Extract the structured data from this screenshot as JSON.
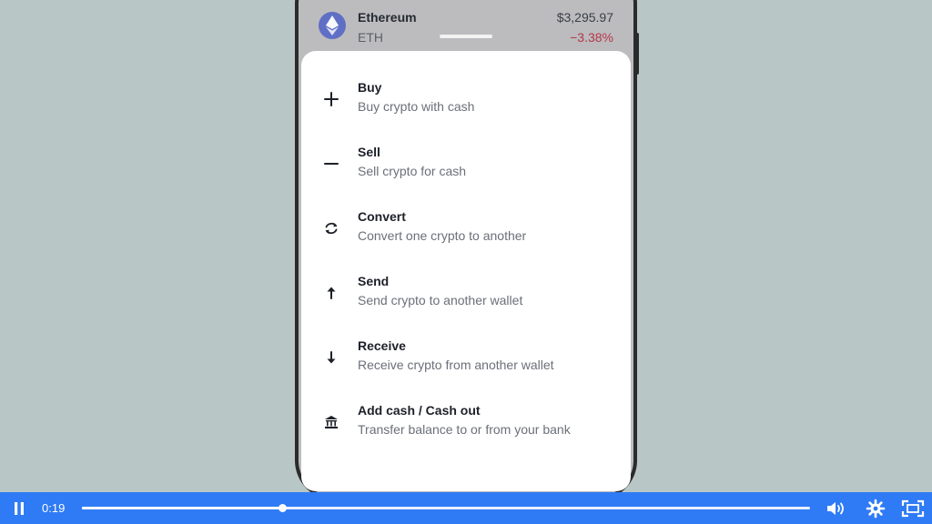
{
  "asset": {
    "name": "Ethereum",
    "symbol": "ETH",
    "price": "$3,295.97",
    "change": "−3.38%",
    "logo_icon": "ethereum-icon",
    "logo_color": "#5f6fc5",
    "change_color": "#b5364a"
  },
  "menu": {
    "items": [
      {
        "id": "buy",
        "icon": "plus-icon",
        "title": "Buy",
        "subtitle": "Buy crypto with cash"
      },
      {
        "id": "sell",
        "icon": "minus-icon",
        "title": "Sell",
        "subtitle": "Sell crypto for cash"
      },
      {
        "id": "convert",
        "icon": "refresh-icon",
        "title": "Convert",
        "subtitle": "Convert one crypto to another"
      },
      {
        "id": "send",
        "icon": "arrow-up-icon",
        "title": "Send",
        "subtitle": "Send crypto to another wallet"
      },
      {
        "id": "receive",
        "icon": "arrow-down-icon",
        "title": "Receive",
        "subtitle": "Receive crypto from another wallet"
      },
      {
        "id": "add-cash",
        "icon": "bank-icon",
        "title": "Add cash / Cash out",
        "subtitle": "Transfer balance to or from your bank"
      }
    ]
  },
  "player": {
    "current_time": "0:19",
    "progress_fraction": 0.275,
    "accent_color": "#2f7bf5",
    "icons": [
      "pause-icon",
      "volume-icon",
      "settings-gear-icon",
      "fullscreen-icon"
    ]
  }
}
